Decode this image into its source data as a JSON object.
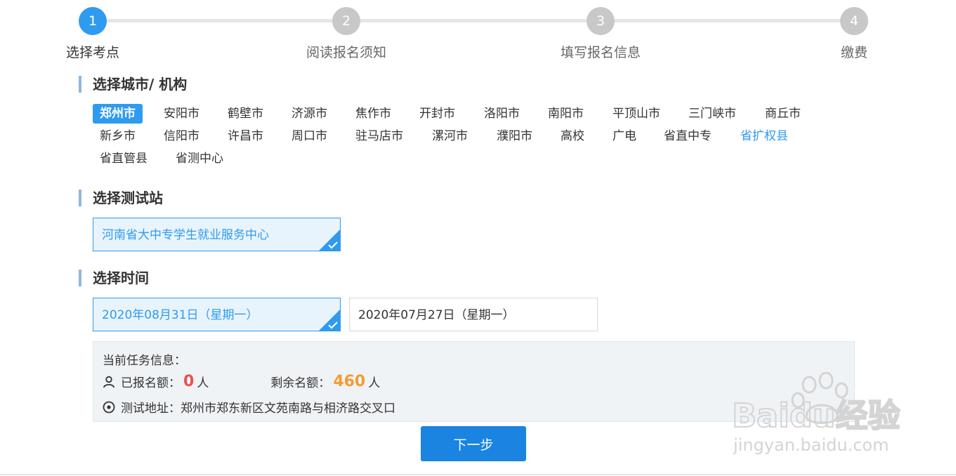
{
  "steps": [
    {
      "number": "1",
      "label": "选择考点"
    },
    {
      "number": "2",
      "label": "阅读报名须知"
    },
    {
      "number": "3",
      "label": "填写报名信息"
    },
    {
      "number": "4",
      "label": "缴费"
    }
  ],
  "sections": {
    "city": "选择城市/ 机构",
    "station": "选择测试站",
    "time": "选择时间"
  },
  "cities": [
    "郑州市",
    "安阳市",
    "鹤壁市",
    "济源市",
    "焦作市",
    "开封市",
    "洛阳市",
    "南阳市",
    "平顶山市",
    "三门峡市",
    "商丘市",
    "新乡市",
    "信阳市",
    "许昌市",
    "周口市",
    "驻马店市",
    "漯河市",
    "濮阳市",
    "高校",
    "广电",
    "省直中专",
    "省扩权县",
    "省直管县",
    "省测中心"
  ],
  "selected_city": "郑州市",
  "highlight_city": "省扩权县",
  "station": {
    "label": "河南省大中专学生就业服务中心",
    "selected": true
  },
  "times": [
    {
      "label": "2020年08月31日（星期一）",
      "selected": true
    },
    {
      "label": "2020年07月27日（星期一）",
      "selected": false
    }
  ],
  "info": {
    "title": "当前任务信息：",
    "registered_label": "已报名额：",
    "registered_count": "0",
    "registered_unit": "人",
    "remaining_label": "剩余名额：",
    "remaining_count": "460",
    "remaining_unit": "人",
    "address_label": "测试地址：",
    "address": "郑州市郑东新区文苑南路与相济路交叉口"
  },
  "next_button": "下一步",
  "watermark": {
    "brand": "Baidu经验",
    "url": "jingyan.baidu.com"
  },
  "colors": {
    "accent": "#2e9bf0",
    "button": "#1a84e0",
    "red": "#e9524a",
    "orange": "#f39c32"
  },
  "icons": {
    "person": "person-icon",
    "location": "location-pin-icon",
    "check": "check-icon"
  }
}
